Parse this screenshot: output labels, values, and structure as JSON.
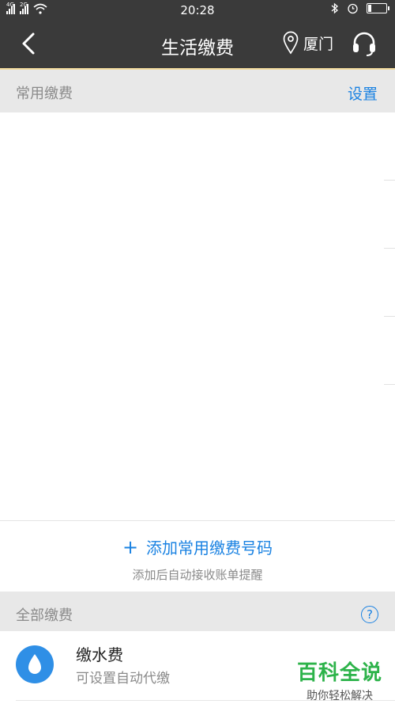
{
  "status_bar": {
    "net1": "4G",
    "net2": "2G",
    "time": "20:28",
    "battery_level": 0.2
  },
  "nav": {
    "title": "生活缴费",
    "city": "厦门"
  },
  "frequent": {
    "header": "常用缴费",
    "settings": "设置",
    "add_label": "添加常用缴费号码",
    "add_plus": "+",
    "add_hint": "添加后自动接收账单提醒"
  },
  "all": {
    "header": "全部缴费",
    "help": "?"
  },
  "items": [
    {
      "name": "缴水费",
      "sub": "可设置自动代缴",
      "icon": "water-drop-icon",
      "color": "#2f8fe6"
    }
  ],
  "watermark": {
    "title": "百科全说",
    "subtitle": "助你轻松解决"
  }
}
